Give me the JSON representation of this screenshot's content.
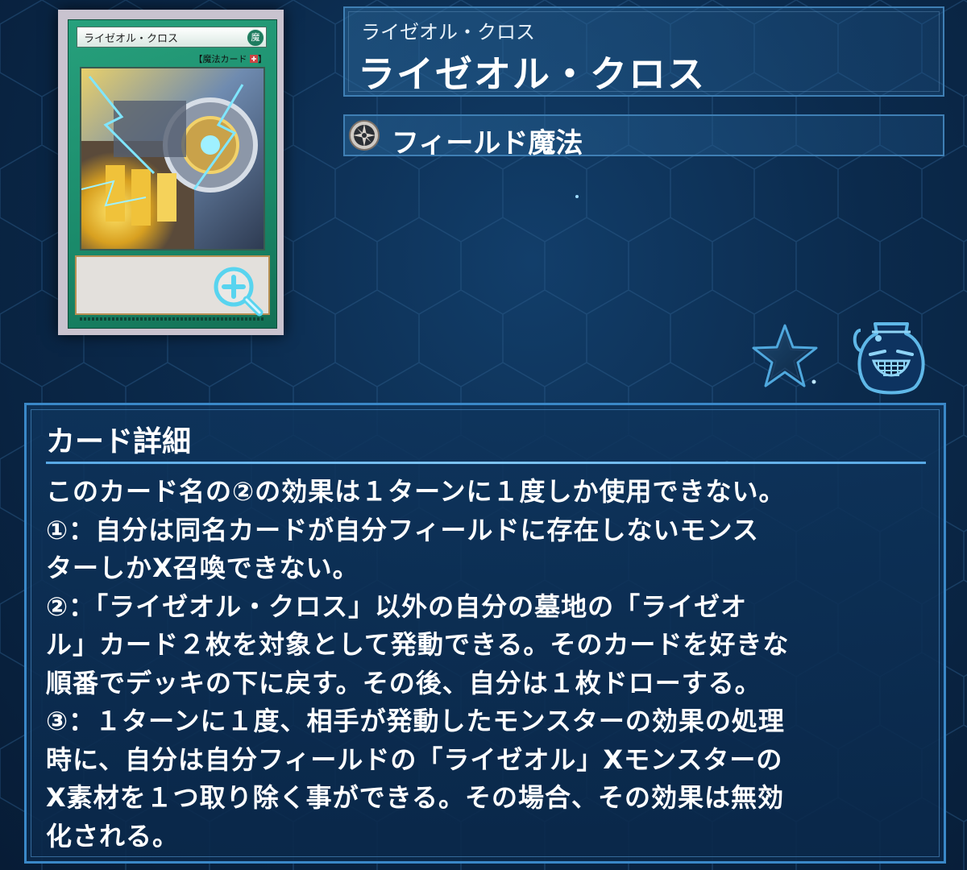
{
  "card": {
    "name_reading": "ライゼオル・クロス",
    "name": "ライゼオル・クロス",
    "type_label": "フィールド魔法",
    "thumbnail": {
      "name": "ライゼオル・クロス",
      "attribute_glyph": "魔",
      "type_line": "【魔法カード",
      "frame_color": "#1a8a6a"
    }
  },
  "icons": {
    "type": "spell-field-icon",
    "zoom": "zoom-in-icon",
    "favorite": "star-icon",
    "pot": "pot-of-greed-icon"
  },
  "details": {
    "heading": "カード詳細",
    "lines": [
      "このカード名の②の効果は１ターンに１度しか使用できない。",
      "①：自分は同名カードが自分フィールドに存在しないモンス",
      "ターしかX召喚できない。",
      "②：「ライゼオル・クロス」以外の自分の墓地の「ライゼオ",
      "ル」カード２枚を対象として発動できる。そのカードを好きな",
      "順番でデッキの下に戻す。その後、自分は１枚ドローする。",
      "③：１ターンに１度、相手が発動したモンスターの効果の処理",
      "時に、自分は自分フィールドの「ライゼオル」Xモンスターの",
      "X素材を１つ取り除く事ができる。その場合、その効果は無効",
      "化される。"
    ]
  },
  "colors": {
    "background": "#0b2a4c",
    "panel_border": "#3a88c8",
    "text": "#ffffff"
  }
}
